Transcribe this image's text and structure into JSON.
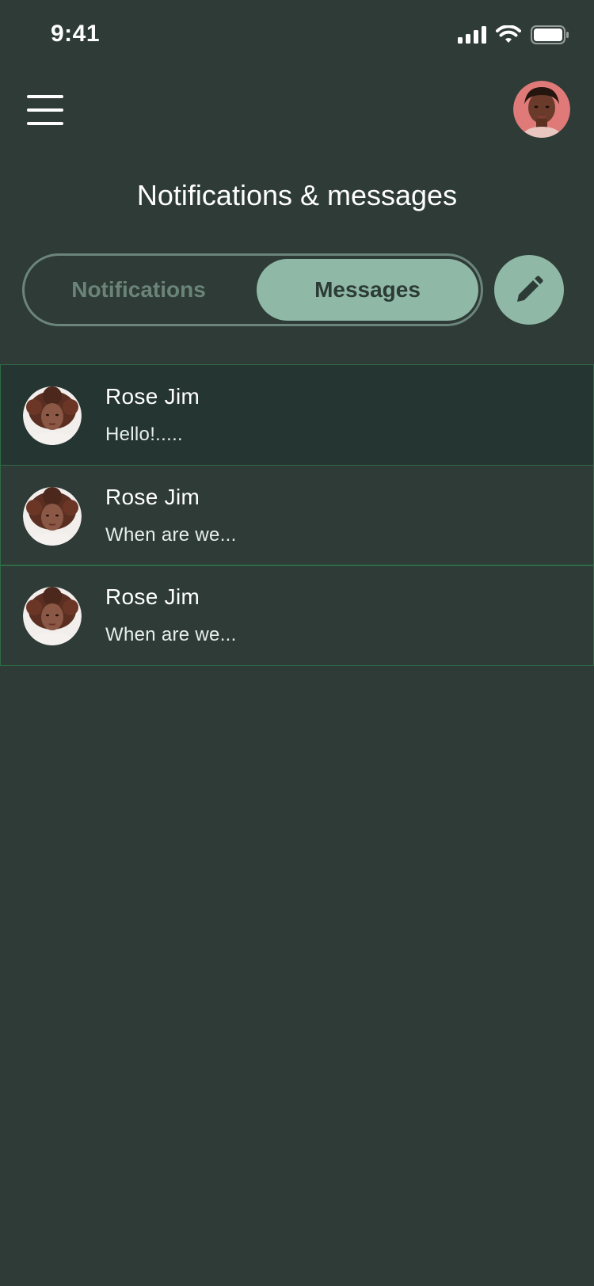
{
  "status_bar": {
    "time": "9:41",
    "icons": [
      "signal-icon",
      "wifi-icon",
      "battery-icon"
    ]
  },
  "header": {
    "menu_icon": "hamburger-menu-icon",
    "profile_avatar": "user-avatar"
  },
  "page": {
    "title": "Notifications & messages"
  },
  "tabs": [
    {
      "label": "Notifications",
      "active": false
    },
    {
      "label": "Messages",
      "active": true
    }
  ],
  "compose_icon": "pencil-icon",
  "messages": [
    {
      "name": "Rose Jim",
      "preview": "Hello!.....",
      "selected": true
    },
    {
      "name": "Rose Jim",
      "preview": "When are we...",
      "selected": false
    },
    {
      "name": "Rose Jim",
      "preview": "When are we...",
      "selected": false
    }
  ],
  "colors": {
    "background": "#2e3b37",
    "accent": "#8fb9a6",
    "selected_row": "#253531",
    "row_border": "#2d6a45",
    "inactive_tab_text": "#6b8479"
  }
}
